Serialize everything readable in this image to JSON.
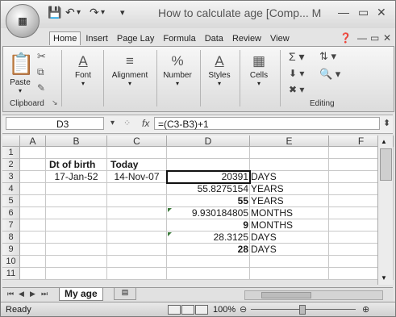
{
  "window": {
    "title": "How to calculate age  [Comp...",
    "title_suffix": "M",
    "quick_access": [
      "save-icon",
      "undo-icon",
      "redo-icon",
      "customize-icon"
    ]
  },
  "ribbon": {
    "tabs": [
      "Home",
      "Insert",
      "Page Lay",
      "Formula",
      "Data",
      "Review",
      "View"
    ],
    "active_tab": "Home",
    "groups": {
      "clipboard": {
        "label": "Clipboard",
        "paste": "Paste"
      },
      "font": "Font",
      "alignment": "Alignment",
      "number": "Number",
      "styles": "Styles",
      "cells": "Cells",
      "editing": "Editing"
    }
  },
  "formula_bar": {
    "name_box": "D3",
    "fx_symbol": "fx",
    "formula": "=(C3-B3)+1"
  },
  "grid": {
    "columns": [
      "A",
      "B",
      "C",
      "D",
      "E",
      "F"
    ],
    "rows": [
      "1",
      "2",
      "3",
      "4",
      "5",
      "6",
      "7",
      "8",
      "9",
      "10",
      "11"
    ],
    "cells": {
      "B2": "Dt of birth",
      "C2": "Today",
      "B3": "17-Jan-52",
      "C3": "14-Nov-07",
      "D3": "20391",
      "E3": "DAYS",
      "D4": "55.8275154",
      "E4": "YEARS",
      "D5": "55",
      "E5": "YEARS",
      "D6": "9.930184805",
      "E6": "MONTHS",
      "D7": "9",
      "E7": "MONTHS",
      "D8": "28.3125",
      "E8": "DAYS",
      "D9": "28",
      "E9": "DAYS"
    }
  },
  "sheets": {
    "active": "My age"
  },
  "status_bar": {
    "status": "Ready",
    "zoom": "100%"
  }
}
